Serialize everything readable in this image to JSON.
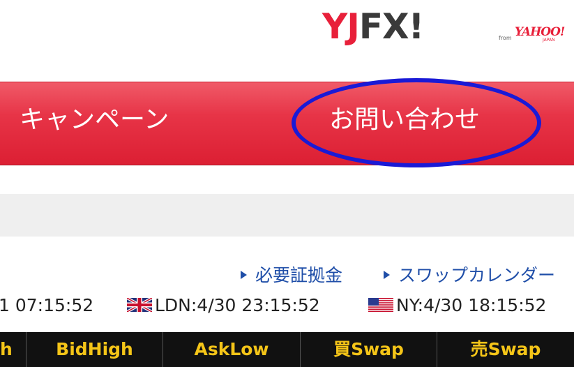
{
  "logo": {
    "main_red": "YJ",
    "main_dark": "FX!",
    "from": "from",
    "yahoo": "YAHOO!",
    "japan": "JAPAN"
  },
  "nav": {
    "campaign": "キャンペーン",
    "contact": "お問い合わせ",
    "highlight_color": "#1a1ad6"
  },
  "links": {
    "margin": "必要証拠金",
    "swap_calendar": "スワップカレンダー"
  },
  "times": {
    "tokyo": "1 07:15:52",
    "ldn": "LDN:4/30 23:15:52",
    "ny": "NY:4/30 18:15:52"
  },
  "table": {
    "columns": [
      "h",
      "BidHigh",
      "AskLow",
      "買Swap",
      "売Swap"
    ]
  },
  "colors": {
    "nav_red": "#e73447",
    "link_blue": "#1f4ea8",
    "header_gold": "#f5c518"
  }
}
